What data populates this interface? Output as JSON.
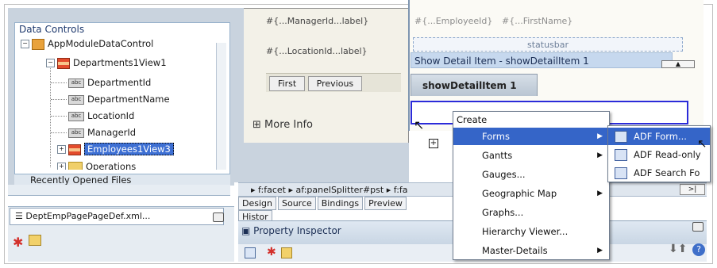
{
  "data_controls": {
    "title": "Data Controls",
    "items": [
      {
        "label": "AppModuleDataControl"
      },
      {
        "label": "Departments1View1"
      },
      {
        "label": "DepartmentId"
      },
      {
        "label": "DepartmentName"
      },
      {
        "label": "LocationId"
      },
      {
        "label": "ManagerId"
      },
      {
        "label": "Employees1View3"
      },
      {
        "label": "Operations"
      }
    ],
    "recent_files": "Recently Opened Files"
  },
  "page_def_tab": "DeptEmpPagePageDef.xml...",
  "editor": {
    "manager_binding": "#{...ManagerId...label}",
    "location_binding": "#{...LocationId...label}",
    "first_button": "First",
    "previous_button": "Previous",
    "more_info": "More Info",
    "employee_col": "#{...EmployeeId}",
    "firstname_col": "#{...FirstName}",
    "statusbar": "statusbar",
    "detail_title": "Show Detail Item - showDetailItem 1",
    "detail_tab": "showDetailItem 1"
  },
  "breadcrumb": [
    "f:facet",
    "af:panelSplitter#pst",
    "f:fa"
  ],
  "bottom_tabs": [
    "Design",
    "Source",
    "Bindings",
    "Preview",
    "Histor"
  ],
  "property_inspector": "Property Inspector",
  "context_menu": {
    "header": "Create",
    "items": [
      {
        "label": "Forms",
        "submenu": true,
        "highlighted": true
      },
      {
        "label": "Gantts",
        "submenu": true
      },
      {
        "label": "Gauges...",
        "submenu": false
      },
      {
        "label": "Geographic Map",
        "submenu": true
      },
      {
        "label": "Graphs...",
        "submenu": false
      },
      {
        "label": "Hierarchy Viewer...",
        "submenu": false
      },
      {
        "label": "Master-Details",
        "submenu": true
      }
    ]
  },
  "submenu": {
    "items": [
      {
        "label": "ADF Form...",
        "highlighted": true
      },
      {
        "label": "ADF Read-only"
      },
      {
        "label": "ADF Search Fo"
      }
    ]
  },
  "colors": {
    "highlight": "#3565c8",
    "selected": "#3d6fd3"
  }
}
